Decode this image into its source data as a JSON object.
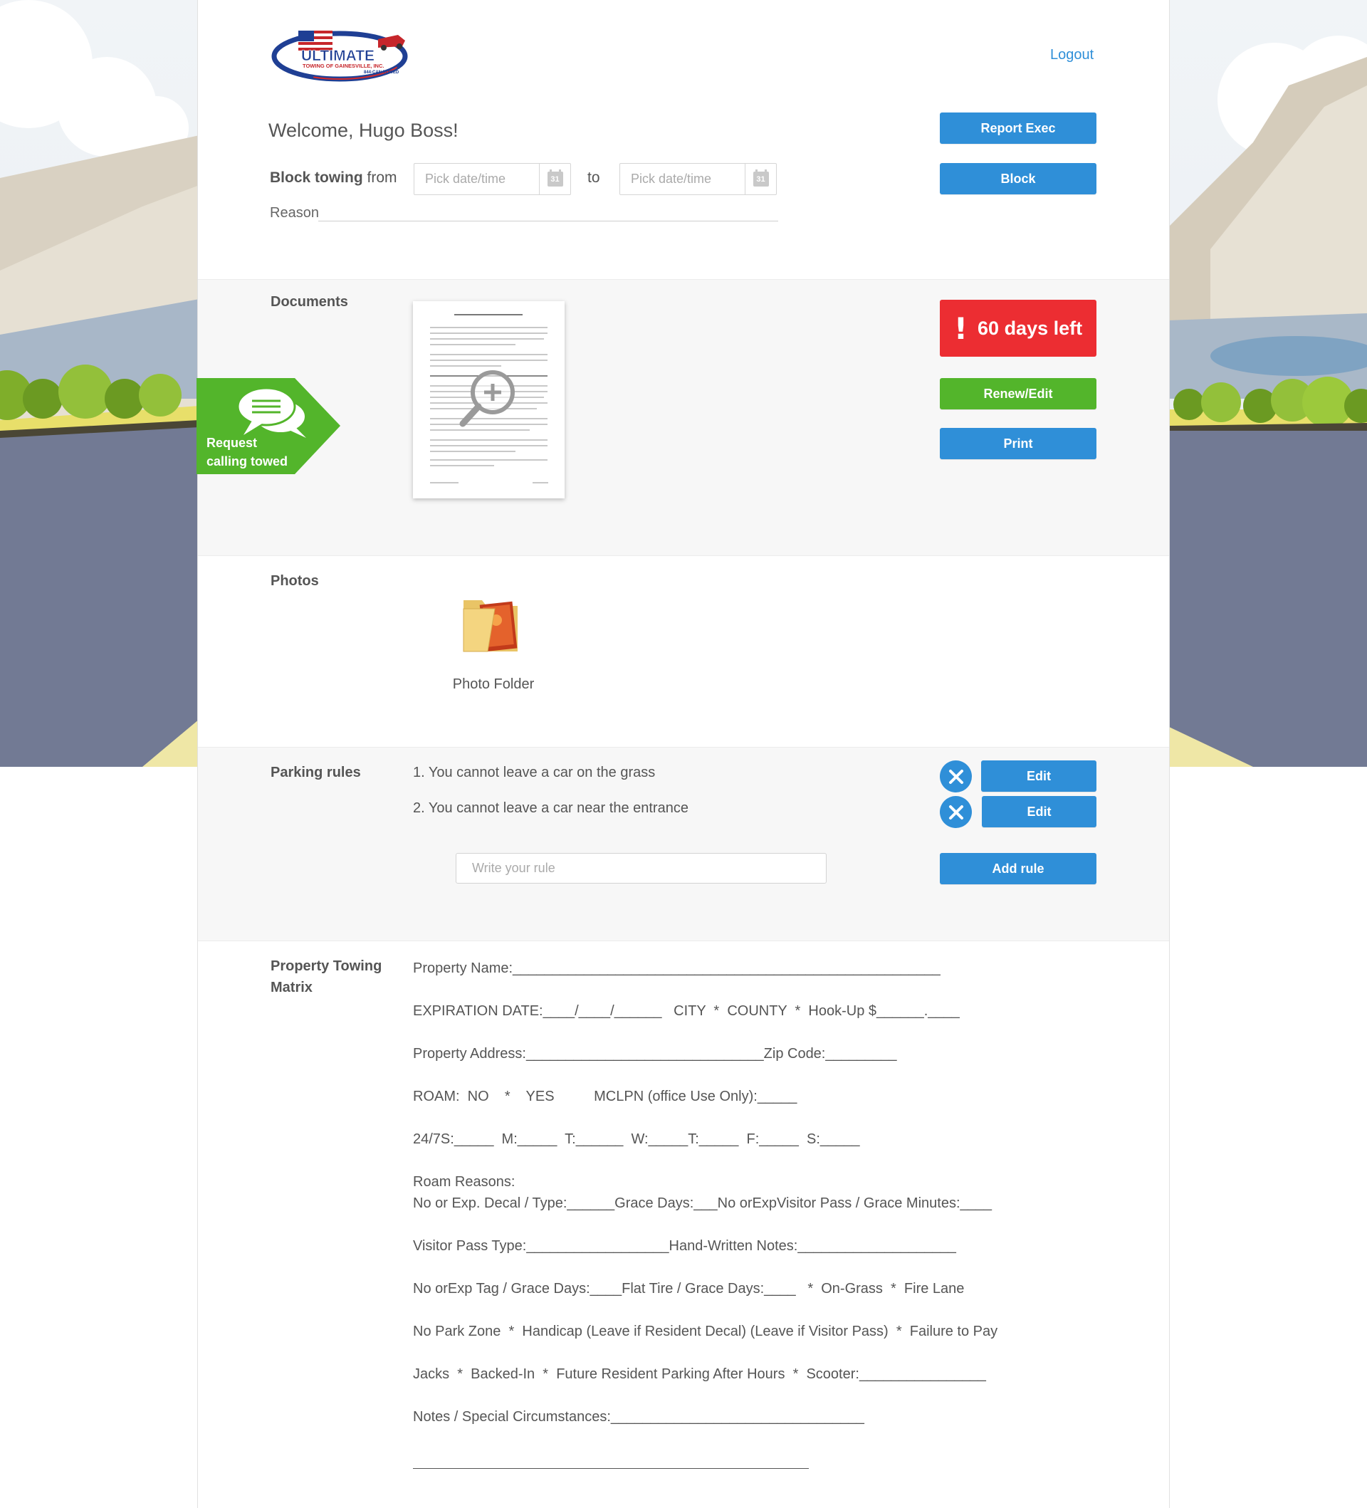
{
  "header": {
    "logo": {
      "line1": "ULTIMATE",
      "line2": "TOWING OF GAINESVILLE, INC.",
      "line3": "844-CAN-TOWED"
    },
    "logout_label": "Logout",
    "welcome": "Welcome, Hugo Boss!",
    "report_exec_label": "Report Exec",
    "block_label": "Block",
    "block_towing_bold": "Block towing",
    "block_towing_rest": " from",
    "from_placeholder": "Pick date/time",
    "to_label": "to",
    "to_placeholder": "Pick date/time",
    "calendar_day": "31",
    "reason_label": "Reason"
  },
  "request_tag": {
    "line1": "Request",
    "line2": "calling towed"
  },
  "documents": {
    "title": "Documents",
    "days_left": "60 days left",
    "renew_label": "Renew/Edit",
    "print_label": "Print"
  },
  "photos": {
    "title": "Photos",
    "folder_label": "Photo Folder"
  },
  "parking_rules": {
    "title": "Parking rules",
    "rules": [
      "1. You cannot leave a car on the grass",
      "2. You cannot leave a car near the entrance"
    ],
    "edit_label": "Edit",
    "input_placeholder": "Write your rule",
    "add_label": "Add rule"
  },
  "matrix": {
    "title_line1": "Property Towing",
    "title_line2": "Matrix",
    "lines": [
      "Property Name:______________________________________________________",
      "EXPIRATION DATE:____/____/______   CITY  *  COUNTY  *  Hook-Up $______.____",
      "Property Address:______________________________Zip Code:_________",
      "ROAM:  NO    *    YES          MCLPN (office Use Only):_____",
      "24/7S:_____  M:_____  T:______  W:_____T:_____  F:_____  S:_____",
      "Roam Reasons:",
      "No or Exp. Decal / Type:______Grace Days:___No orExpVisitor Pass / Grace Minutes:____",
      "Visitor Pass Type:__________________Hand-Written Notes:____________________",
      "No orExp Tag / Grace Days:____Flat Tire / Grace Days:____   *  On-Grass  *  Fire Lane",
      "No Park Zone  *  Handicap (Leave if Resident Decal) (Leave if Visitor Pass)  *  Failure to Pay",
      "Jacks  *  Backed-In  *  Future Resident Parking After Hours  *  Scooter:________________",
      "Notes / Special Circumstances:________________________________"
    ]
  },
  "colors": {
    "primary": "#2f8fd8",
    "success": "#53b52b",
    "danger": "#ec2d32"
  }
}
